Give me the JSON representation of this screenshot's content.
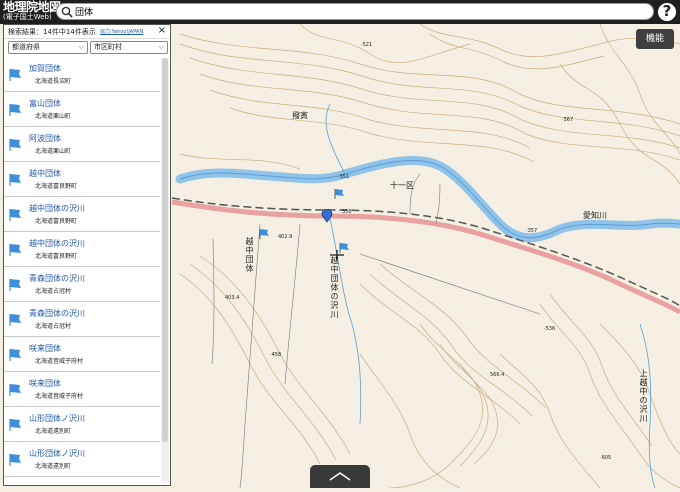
{
  "header": {
    "logo_main": "地理院地図",
    "logo_sub": "(電子国土Web)",
    "search_value": "団体",
    "help_label": "?"
  },
  "map": {
    "function_button": "機能",
    "labels": {
      "basin": "撥寅",
      "district": "十一区",
      "river": "愛知川",
      "village": "越中団体",
      "stream": "越中団体の沢川",
      "upper_stream": "上越中の沢川",
      "elev_521": "·521",
      "elev_567": "·567",
      "elev_351": "·351",
      "elev_357": "·357",
      "elev_4029": "402.9",
      "elev_4034": "403.4",
      "elev_458": "·458",
      "elev_536": "·536",
      "elev_5664": "566.4",
      "elev_605": "·605",
      "elev_356": "356"
    }
  },
  "panel": {
    "title": "検索結果：14件中14件表示",
    "source": "協力:Yahoo!JAPAN",
    "close": "×",
    "prefecture_select": "都道府県",
    "city_select": "市区町村",
    "items": [
      {
        "name": "加賀団体",
        "sub": "北海道長沼町"
      },
      {
        "name": "富山団体",
        "sub": "北海道栗山町"
      },
      {
        "name": "阿波団体",
        "sub": "北海道栗山町"
      },
      {
        "name": "越中団体",
        "sub": "北海道富良野町"
      },
      {
        "name": "越中団体の沢川",
        "sub": "北海道富良野町"
      },
      {
        "name": "越中団体の沢川",
        "sub": "北海道富良野町"
      },
      {
        "name": "青森団体の沢川",
        "sub": "北海道占冠村"
      },
      {
        "name": "青森団体の沢川",
        "sub": "北海道占冠村"
      },
      {
        "name": "咲来団体",
        "sub": "北海道音威子府村"
      },
      {
        "name": "咲来団体",
        "sub": "北海道音威子府村"
      },
      {
        "name": "山形団体ノ沢川",
        "sub": "北海道遠別町"
      },
      {
        "name": "山形団体ノ沢川",
        "sub": "北海道遠別町"
      }
    ]
  },
  "colors": {
    "header_bg": "#1f1f1f",
    "map_bg": "#f4efe2",
    "contour": "#c9a877",
    "river": "#8fc3ea",
    "road": "#e8a0a0",
    "rail": "#555555",
    "link": "#2257a8",
    "flag": "#3f8ed8"
  }
}
